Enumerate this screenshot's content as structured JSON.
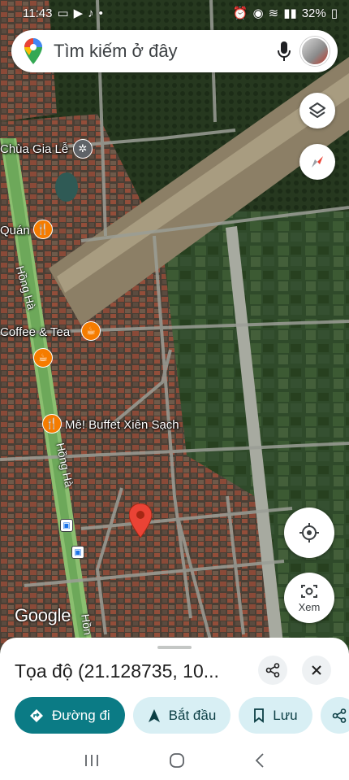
{
  "status_bar": {
    "time": "11:43",
    "battery": "32%"
  },
  "search": {
    "placeholder": "Tìm kiếm ở đây"
  },
  "map": {
    "labels": {
      "chua_gia_le": "Chùa Gia Lễ",
      "quan": "Quán",
      "coffee_tea": "Coffee & Tea",
      "buffet": "Mê! Buffet Xiên Sạch",
      "road_hong_ha_1": "Hồng Hà",
      "road_hong_ha_2": "Hồng Hà",
      "road_hong_ha_3": "Hồn"
    },
    "google_logo": "Google",
    "xem_label": "Xem"
  },
  "place": {
    "title": "Tọa độ (21.128735, 10..."
  },
  "actions": {
    "directions": "Đường đi",
    "start": "Bắt đầu",
    "save": "Lưu"
  },
  "colors": {
    "primary": "#0b7b85",
    "chip_secondary": "#d8eff4",
    "pin": "#ea4335",
    "poi_orange": "#f57c00"
  }
}
